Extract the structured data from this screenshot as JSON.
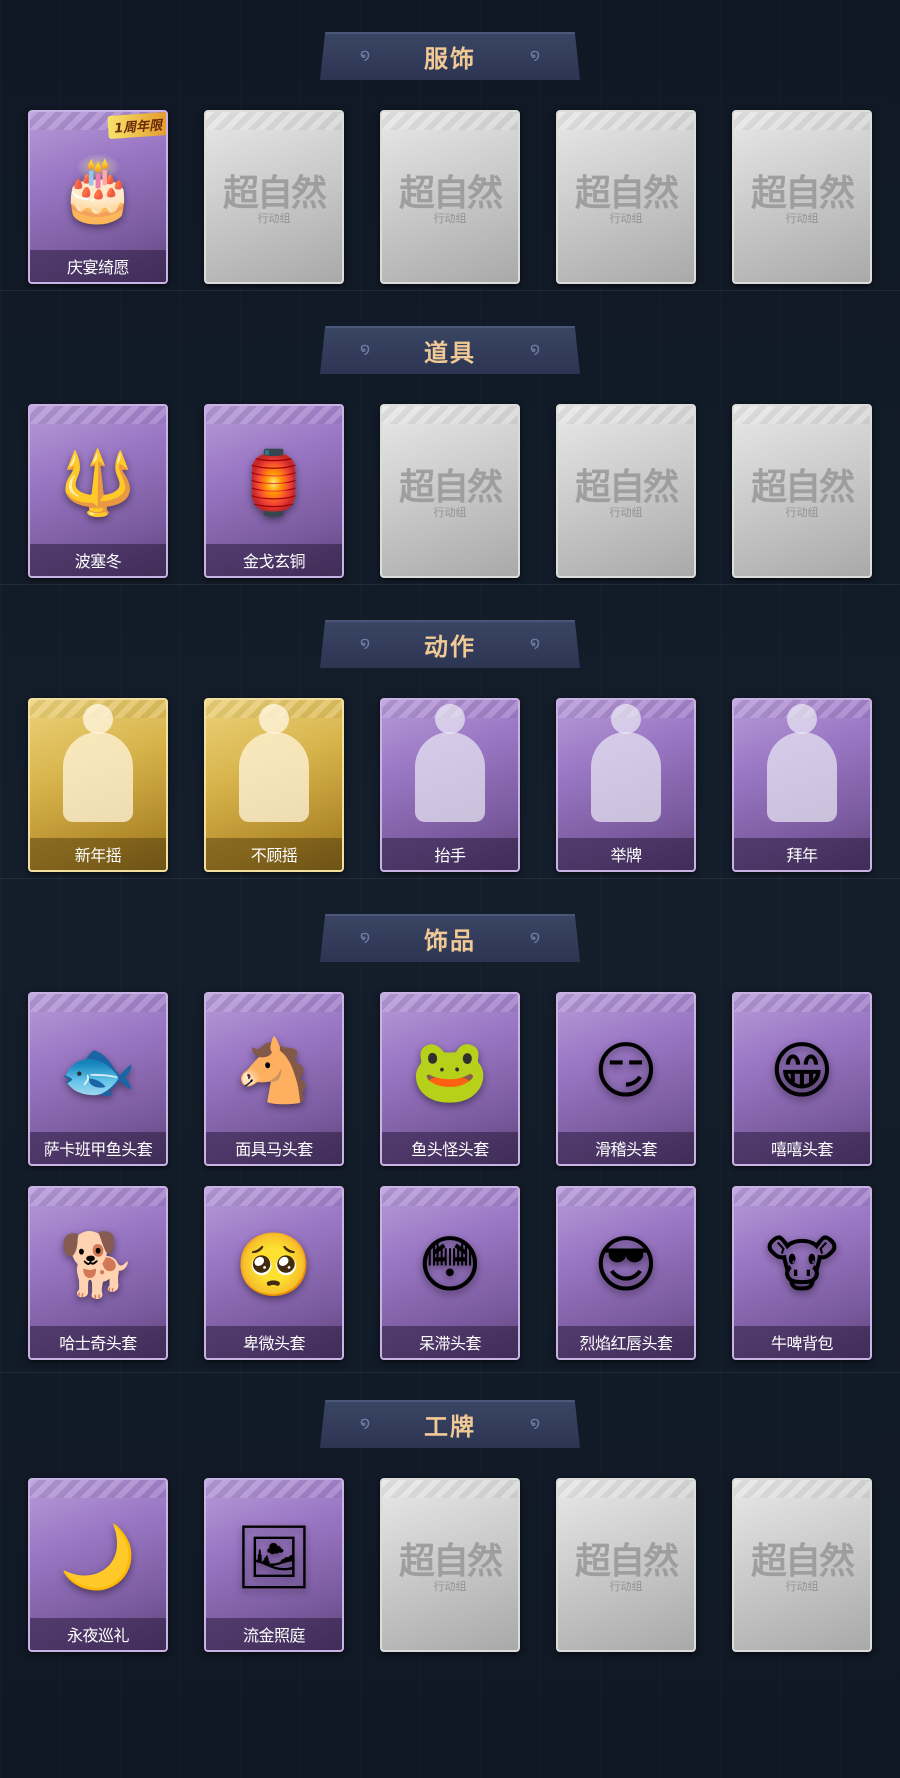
{
  "sections": [
    {
      "title": "服饰",
      "items": [
        {
          "label": "庆宴绮愿",
          "style": "purple",
          "icon": "costume-portrait-icon",
          "glyph": "🎂",
          "badge": "1周年限"
        },
        {
          "label": "",
          "style": "empty",
          "watermark": "超自然",
          "watermark_sub": "行动组"
        },
        {
          "label": "",
          "style": "empty",
          "watermark": "超自然",
          "watermark_sub": "行动组"
        },
        {
          "label": "",
          "style": "empty",
          "watermark": "超自然",
          "watermark_sub": "行动组"
        },
        {
          "label": "",
          "style": "empty",
          "watermark": "超自然",
          "watermark_sub": "行动组"
        }
      ]
    },
    {
      "title": "道具",
      "items": [
        {
          "label": "波塞冬",
          "style": "purple",
          "icon": "trident-icon",
          "glyph": "🔱"
        },
        {
          "label": "金戈玄铜",
          "style": "purple",
          "icon": "bronze-lantern-icon",
          "glyph": "🏮"
        },
        {
          "label": "",
          "style": "empty",
          "watermark": "超自然",
          "watermark_sub": "行动组"
        },
        {
          "label": "",
          "style": "empty",
          "watermark": "超自然",
          "watermark_sub": "行动组"
        },
        {
          "label": "",
          "style": "empty",
          "watermark": "超自然",
          "watermark_sub": "行动组"
        }
      ]
    },
    {
      "title": "动作",
      "items": [
        {
          "label": "新年摇",
          "style": "gold",
          "icon": "dance-pose-icon"
        },
        {
          "label": "不顾摇",
          "style": "gold",
          "icon": "dance-pose-icon"
        },
        {
          "label": "抬手",
          "style": "purple",
          "icon": "raise-hand-pose-icon"
        },
        {
          "label": "举牌",
          "style": "purple",
          "icon": "hold-sign-pose-icon"
        },
        {
          "label": "拜年",
          "style": "purple",
          "icon": "greeting-pose-icon"
        }
      ]
    },
    {
      "title": "饰品",
      "items": [
        {
          "label": "萨卡班甲鱼头套",
          "style": "purple",
          "icon": "fish-head-mask-icon",
          "glyph": "🐟"
        },
        {
          "label": "面具马头套",
          "style": "purple",
          "icon": "horse-head-mask-icon",
          "glyph": "🐴"
        },
        {
          "label": "鱼头怪头套",
          "style": "purple",
          "icon": "fishman-mask-icon",
          "glyph": "🐸"
        },
        {
          "label": "滑稽头套",
          "style": "purple",
          "icon": "funny-face-mask-icon",
          "glyph": "😏"
        },
        {
          "label": "嘻嘻头套",
          "style": "purple",
          "icon": "grin-face-mask-icon",
          "glyph": "😁"
        },
        {
          "label": "哈士奇头套",
          "style": "purple",
          "icon": "husky-mask-icon",
          "glyph": "🐕"
        },
        {
          "label": "卑微头套",
          "style": "purple",
          "icon": "humble-face-mask-icon",
          "glyph": "🥺"
        },
        {
          "label": "呆滞头套",
          "style": "purple",
          "icon": "dazed-face-mask-icon",
          "glyph": "😳"
        },
        {
          "label": "烈焰红唇头套",
          "style": "purple",
          "icon": "red-lips-mask-icon",
          "glyph": "😎"
        },
        {
          "label": "牛啤背包",
          "style": "purple",
          "icon": "cow-beer-backpack-icon",
          "glyph": "🐮"
        }
      ]
    },
    {
      "title": "工牌",
      "items": [
        {
          "label": "永夜巡礼",
          "style": "purple",
          "icon": "night-card-icon",
          "glyph": "🌙"
        },
        {
          "label": "流金照庭",
          "style": "purple",
          "icon": "gold-frame-card-icon",
          "glyph": "🖼"
        },
        {
          "label": "",
          "style": "empty",
          "watermark": "超自然",
          "watermark_sub": "行动组"
        },
        {
          "label": "",
          "style": "empty",
          "watermark": "超自然",
          "watermark_sub": "行动组"
        },
        {
          "label": "",
          "style": "empty",
          "watermark": "超自然",
          "watermark_sub": "行动组"
        }
      ]
    }
  ]
}
